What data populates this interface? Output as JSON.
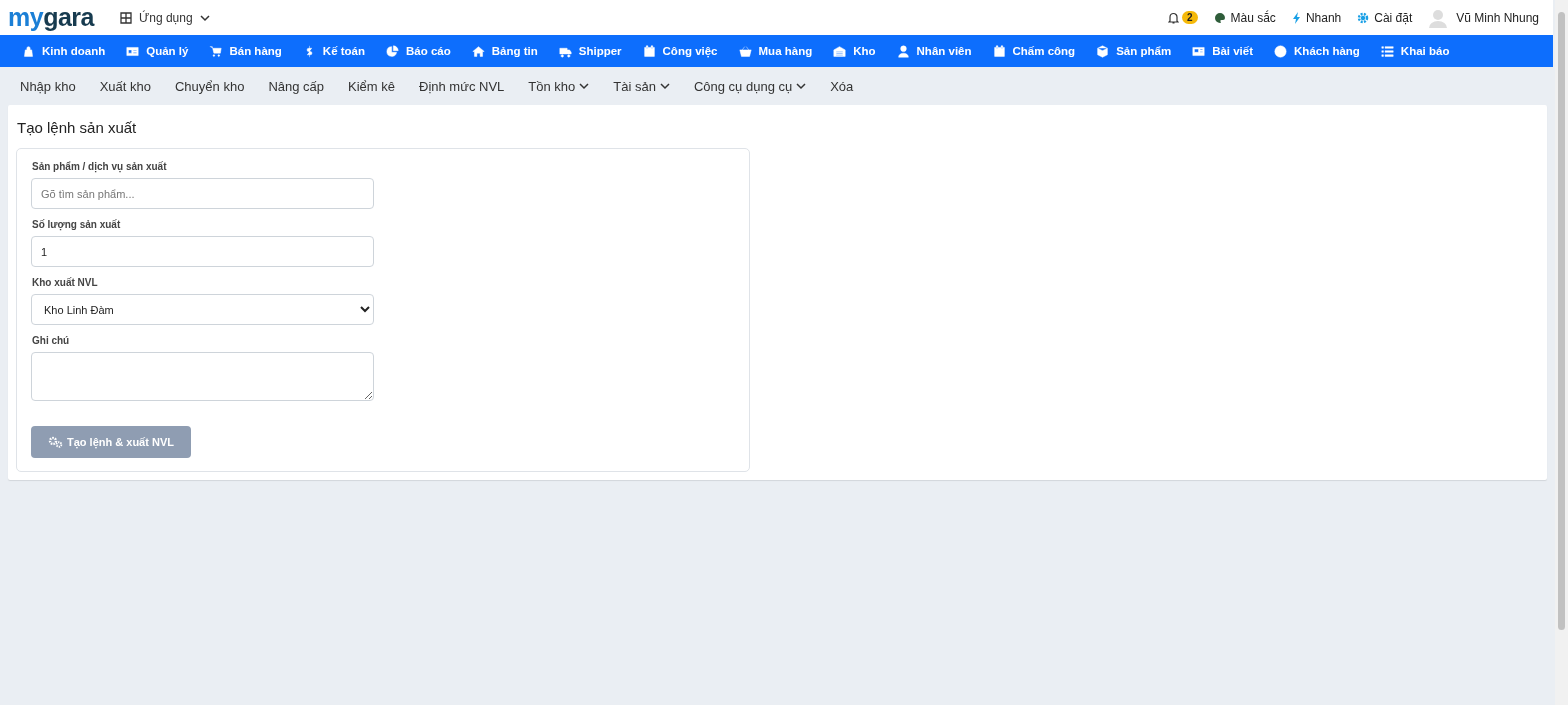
{
  "header": {
    "logo_a": "my",
    "logo_b": "gara",
    "apps_menu": "Ứng dụng",
    "notifications": "2",
    "links": [
      "Màu sắc",
      "Nhanh",
      "Cài đặt"
    ],
    "user": "Vũ Minh Nhung"
  },
  "main_nav": [
    "Kinh doanh",
    "Quản lý",
    "Bán hàng",
    "Kế toán",
    "Báo cáo",
    "Bảng tin",
    "Shipper",
    "Công việc",
    "Mua hàng",
    "Kho",
    "Nhân viên",
    "Chấm công",
    "Sản phẩm",
    "Bài viết",
    "Khách hàng",
    "Khai báo"
  ],
  "sub_nav": [
    {
      "label": "Nhập kho",
      "dropdown": false
    },
    {
      "label": "Xuất kho",
      "dropdown": false
    },
    {
      "label": "Chuyển kho",
      "dropdown": false
    },
    {
      "label": "Nâng cấp",
      "dropdown": false
    },
    {
      "label": "Kiểm kê",
      "dropdown": false
    },
    {
      "label": "Định mức NVL",
      "dropdown": false
    },
    {
      "label": "Tồn kho",
      "dropdown": true
    },
    {
      "label": "Tài sản",
      "dropdown": true
    },
    {
      "label": "Công cụ dụng cụ",
      "dropdown": true
    },
    {
      "label": "Xóa",
      "dropdown": false
    }
  ],
  "page_title": "Tạo lệnh sản xuất",
  "form": {
    "product_label": "Sản phẩm / dịch vụ sản xuất",
    "product_placeholder": "Gõ tìm sản phẩm...",
    "quantity_label": "Số lượng sản xuất",
    "quantity_value": "1",
    "warehouse_label": "Kho xuất NVL",
    "warehouse_value": "Kho Linh Đàm",
    "note_label": "Ghi chú",
    "submit": {
      "label": "Tạo lệnh & xuất NVL",
      "disabled": true
    }
  }
}
